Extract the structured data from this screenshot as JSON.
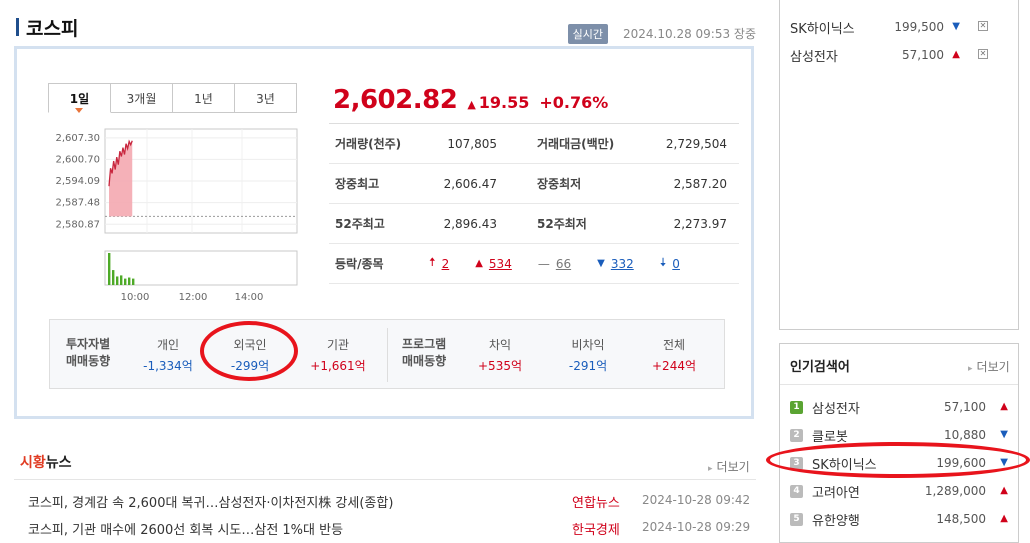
{
  "header": {
    "title": "코스피",
    "realtime_badge": "실시간",
    "timestamp": "2024.10.28 09:53 장중"
  },
  "tabs": [
    {
      "label": "1일",
      "active": true
    },
    {
      "label": "3개월",
      "active": false
    },
    {
      "label": "1년",
      "active": false
    },
    {
      "label": "3년",
      "active": false
    }
  ],
  "chart_data": {
    "type": "area",
    "title": "",
    "y_tick_labels": [
      "2,607.30",
      "2,600.70",
      "2,594.09",
      "2,587.48",
      "2,580.87"
    ],
    "y_ticks": [
      2607.3,
      2600.7,
      2594.09,
      2587.48,
      2580.87
    ],
    "x_tick_labels": [
      "10:00",
      "12:00",
      "14:00"
    ],
    "ylim": [
      2578.2,
      2610.0
    ],
    "baseline": 2583.27,
    "series": [
      {
        "values": [
          2592.5,
          2598.0,
          2596.4,
          2600.2,
          2597.6,
          2601.4,
          2599.1,
          2603.2,
          2601.6,
          2604.3,
          2602.2,
          2605.5,
          2604.0,
          2606.2,
          2605.2,
          2606.4
        ]
      }
    ],
    "volume": [
      30,
      14,
      8,
      9,
      6,
      7,
      6
    ],
    "grid": true,
    "color_price": "#c8263e",
    "color_fill": "#f4a8b0",
    "color_volume": "#4eaa28"
  },
  "quote": {
    "price": "2,602.82",
    "change_arrow": "▲",
    "change": "19.55",
    "change_pct": "+0.76%",
    "color_up": "#d0021b",
    "color_down": "#1a5dbb"
  },
  "stats": {
    "volume_label": "거래량(천주)",
    "volume": "107,805",
    "amount_label": "거래대금(백만)",
    "amount": "2,729,504",
    "high_label": "장중최고",
    "high": "2,606.47",
    "low_label": "장중최저",
    "low": "2,587.20",
    "w52_high_label": "52주최고",
    "w52_high": "2,896.43",
    "w52_low_label": "52주최저",
    "w52_low": "2,273.97",
    "updown_label": "등락/종목",
    "upper_limit": "2",
    "up": "534",
    "flat": "66",
    "down": "332",
    "lower_limit": "0"
  },
  "investor": {
    "head1": "투자자별",
    "head2": "매매동향",
    "individual_label": "개인",
    "individual": "-1,334억",
    "foreign_label": "외국인",
    "foreign": "-299억",
    "institution_label": "기관",
    "institution": "+1,661억",
    "program_head1": "프로그램",
    "program_head2": "매매동향",
    "arb_label": "차익",
    "arb": "+535억",
    "nonarb_label": "비차익",
    "nonarb": "-291억",
    "total_label": "전체",
    "total": "+244억"
  },
  "news": {
    "title_accent": "시황",
    "title_rest": "뉴스",
    "more": "더보기",
    "items": [
      {
        "headline": "코스피, 경계감 속 2,600대 복귀…삼성전자·이차전지株 강세(종합)",
        "source": "연합뉴스",
        "time": "2024-10-28 09:42"
      },
      {
        "headline": "코스피, 기관 매수에 2600선 회복 시도…삼전 1%대 반등",
        "source": "한국경제",
        "time": "2024-10-28 09:29"
      }
    ]
  },
  "watchlist": [
    {
      "name": "SK하이닉스",
      "price": "199,500",
      "dir": "down"
    },
    {
      "name": "삼성전자",
      "price": "57,100",
      "dir": "up"
    }
  ],
  "popular": {
    "title": "인기검색어",
    "more": "더보기",
    "items": [
      {
        "rank": "1",
        "name": "삼성전자",
        "price": "57,100",
        "dir": "up"
      },
      {
        "rank": "2",
        "name": "클로봇",
        "price": "10,880",
        "dir": "down"
      },
      {
        "rank": "3",
        "name": "SK하이닉스",
        "price": "199,600",
        "dir": "down"
      },
      {
        "rank": "4",
        "name": "고려아연",
        "price": "1,289,000",
        "dir": "up"
      },
      {
        "rank": "5",
        "name": "유한양행",
        "price": "148,500",
        "dir": "up"
      }
    ]
  },
  "icons": {
    "up_triangle": "▲",
    "down_triangle": "▼",
    "upper_limit": "🠅",
    "lower_limit": "🠇",
    "flat": "—",
    "more_chevron": "▸",
    "remove": "✕"
  }
}
